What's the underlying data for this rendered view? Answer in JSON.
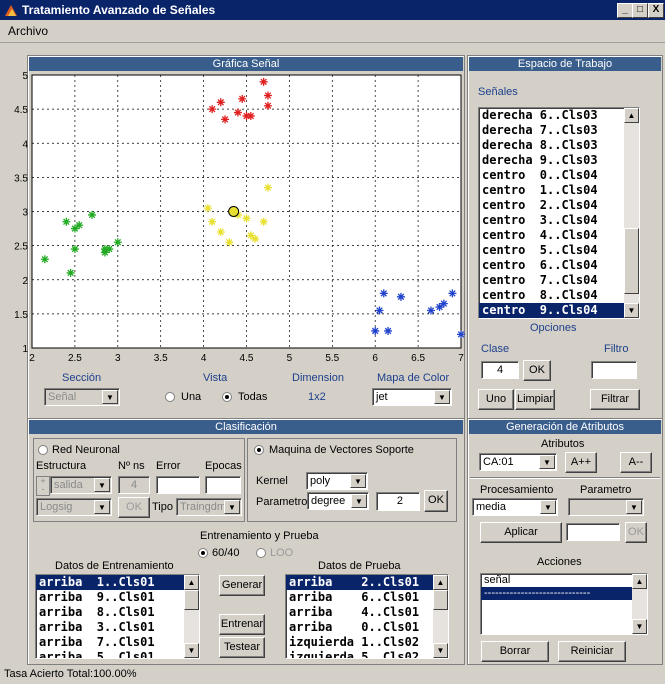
{
  "window": {
    "title": "Tratamiento Avanzado de Señales",
    "min": "_",
    "max": "□",
    "close": "X"
  },
  "menu": {
    "archivo": "Archivo"
  },
  "grafica": {
    "title": "Gráfica Señal",
    "x_ticks": [
      "2",
      "2.5",
      "3",
      "3.5",
      "4",
      "4.5",
      "5",
      "5.5",
      "6",
      "6.5",
      "7"
    ],
    "y_ticks": [
      "1",
      "1.5",
      "2",
      "2.5",
      "3",
      "3.5",
      "4",
      "4.5",
      "5"
    ]
  },
  "chart_data": {
    "type": "scatter",
    "xlim": [
      2,
      7
    ],
    "ylim": [
      1,
      5
    ],
    "grid": true,
    "series": [
      {
        "color": "#22aa22",
        "points": [
          [
            2.15,
            2.3
          ],
          [
            2.4,
            2.85
          ],
          [
            2.45,
            2.1
          ],
          [
            2.5,
            2.75
          ],
          [
            2.5,
            2.45
          ],
          [
            2.55,
            2.8
          ],
          [
            2.7,
            2.95
          ],
          [
            2.85,
            2.45
          ],
          [
            2.85,
            2.4
          ],
          [
            2.9,
            2.45
          ],
          [
            3.0,
            2.55
          ]
        ]
      },
      {
        "color": "#e02020",
        "points": [
          [
            4.1,
            4.5
          ],
          [
            4.2,
            4.6
          ],
          [
            4.25,
            4.35
          ],
          [
            4.4,
            4.45
          ],
          [
            4.45,
            4.65
          ],
          [
            4.5,
            4.4
          ],
          [
            4.55,
            4.4
          ],
          [
            4.7,
            4.9
          ],
          [
            4.75,
            4.55
          ],
          [
            4.75,
            4.7
          ]
        ]
      },
      {
        "color": "#e8e030",
        "points": [
          [
            4.05,
            3.05
          ],
          [
            4.1,
            2.85
          ],
          [
            4.2,
            2.7
          ],
          [
            4.3,
            2.55
          ],
          [
            4.4,
            2.95
          ],
          [
            4.5,
            2.9
          ],
          [
            4.55,
            2.65
          ],
          [
            4.6,
            2.6
          ],
          [
            4.7,
            2.85
          ],
          [
            4.75,
            3.35
          ]
        ]
      },
      {
        "color": "#2244cc",
        "points": [
          [
            6.0,
            1.25
          ],
          [
            6.05,
            1.55
          ],
          [
            6.1,
            1.8
          ],
          [
            6.15,
            1.25
          ],
          [
            6.3,
            1.75
          ],
          [
            6.65,
            1.55
          ],
          [
            6.75,
            1.6
          ],
          [
            6.8,
            1.65
          ],
          [
            6.9,
            1.8
          ],
          [
            7.0,
            1.2
          ]
        ]
      }
    ],
    "highlight": {
      "x": 4.35,
      "y": 3.0
    }
  },
  "controls_top": {
    "seccion_label": "Sección",
    "seccion_value": "Señal",
    "vista_label": "Vista",
    "vista_una": "Una",
    "vista_todas": "Todas",
    "dimension_label": "Dimension",
    "dimension_value": "1x2",
    "mapa_label": "Mapa de Color",
    "mapa_value": "jet"
  },
  "espacio": {
    "title": "Espacio de Trabajo",
    "senales_label": "Señales",
    "items": [
      {
        "name": "derecha",
        "val": "6..Cls03"
      },
      {
        "name": "derecha",
        "val": "7..Cls03"
      },
      {
        "name": "derecha",
        "val": "8..Cls03"
      },
      {
        "name": "derecha",
        "val": "9..Cls03"
      },
      {
        "name": "centro ",
        "val": "0..Cls04"
      },
      {
        "name": "centro ",
        "val": "1..Cls04"
      },
      {
        "name": "centro ",
        "val": "2..Cls04"
      },
      {
        "name": "centro ",
        "val": "3..Cls04"
      },
      {
        "name": "centro ",
        "val": "4..Cls04"
      },
      {
        "name": "centro ",
        "val": "5..Cls04"
      },
      {
        "name": "centro ",
        "val": "6..Cls04"
      },
      {
        "name": "centro ",
        "val": "7..Cls04"
      },
      {
        "name": "centro ",
        "val": "8..Cls04"
      },
      {
        "name": "centro ",
        "val": "9..Cls04"
      }
    ],
    "opciones_label": "Opciones",
    "clase_label": "Clase",
    "filtro_label": "Filtro",
    "clase_value": "4",
    "ok": "OK",
    "uno": "Uno",
    "limpiar": "Limpiar",
    "filtrar": "Filtrar"
  },
  "clasificacion": {
    "title": "Clasificación",
    "red_neuronal": "Red Neuronal",
    "estructura": "Estructura",
    "nns": "Nº ns",
    "error": "Error",
    "epocas": "Epocas",
    "salida": "salida",
    "nns_value": "4",
    "logsig": "Logsig",
    "ok": "OK",
    "tipo": "Tipo",
    "tipo_value": "Traingdm",
    "svm": "Maquina de Vectores Soporte",
    "kernel_label": "Kernel",
    "kernel_value": "poly",
    "parametro_label": "Parametro",
    "parametro_value": "degree",
    "param_num": "2",
    "param_ok": "OK",
    "entrenamiento_prueba": "Entrenamiento y Prueba",
    "split_6040": "60/40",
    "split_loo": "LOO",
    "datos_entrenamiento": "Datos de Entrenamiento",
    "datos_prueba": "Datos de Prueba",
    "train_items": [
      {
        "name": "arriba ",
        "val": "1..Cls01"
      },
      {
        "name": "arriba ",
        "val": "9..Cls01"
      },
      {
        "name": "arriba ",
        "val": "8..Cls01"
      },
      {
        "name": "arriba ",
        "val": "3..Cls01"
      },
      {
        "name": "arriba ",
        "val": "7..Cls01"
      },
      {
        "name": "arriba ",
        "val": "5..Cls01"
      }
    ],
    "test_items": [
      {
        "name": "arriba   ",
        "val": "2..Cls01"
      },
      {
        "name": "arriba   ",
        "val": "6..Cls01"
      },
      {
        "name": "arriba   ",
        "val": "4..Cls01"
      },
      {
        "name": "arriba   ",
        "val": "0..Cls01"
      },
      {
        "name": "izquierda",
        "val": "1..Cls02"
      },
      {
        "name": "izquierda",
        "val": "5..Cls02"
      }
    ],
    "generar": "Generar",
    "entrenar": "Entrenar",
    "testear": "Testear"
  },
  "atributos": {
    "title": "Generación de Atributos",
    "atributos_label": "Atributos",
    "ca_value": "CA:01",
    "app": "A++",
    "amm": "A--",
    "procesamiento_label": "Procesamiento",
    "parametro_label": "Parametro",
    "proc_value": "media",
    "aplicar": "Aplicar",
    "ok": "OK",
    "acciones_label": "Acciones",
    "acciones_items": [
      "señal",
      "-----------------------------"
    ],
    "borrar": "Borrar",
    "reiniciar": "Reiniciar"
  },
  "status": {
    "text": "Tasa Acierto Total:100.00%"
  }
}
